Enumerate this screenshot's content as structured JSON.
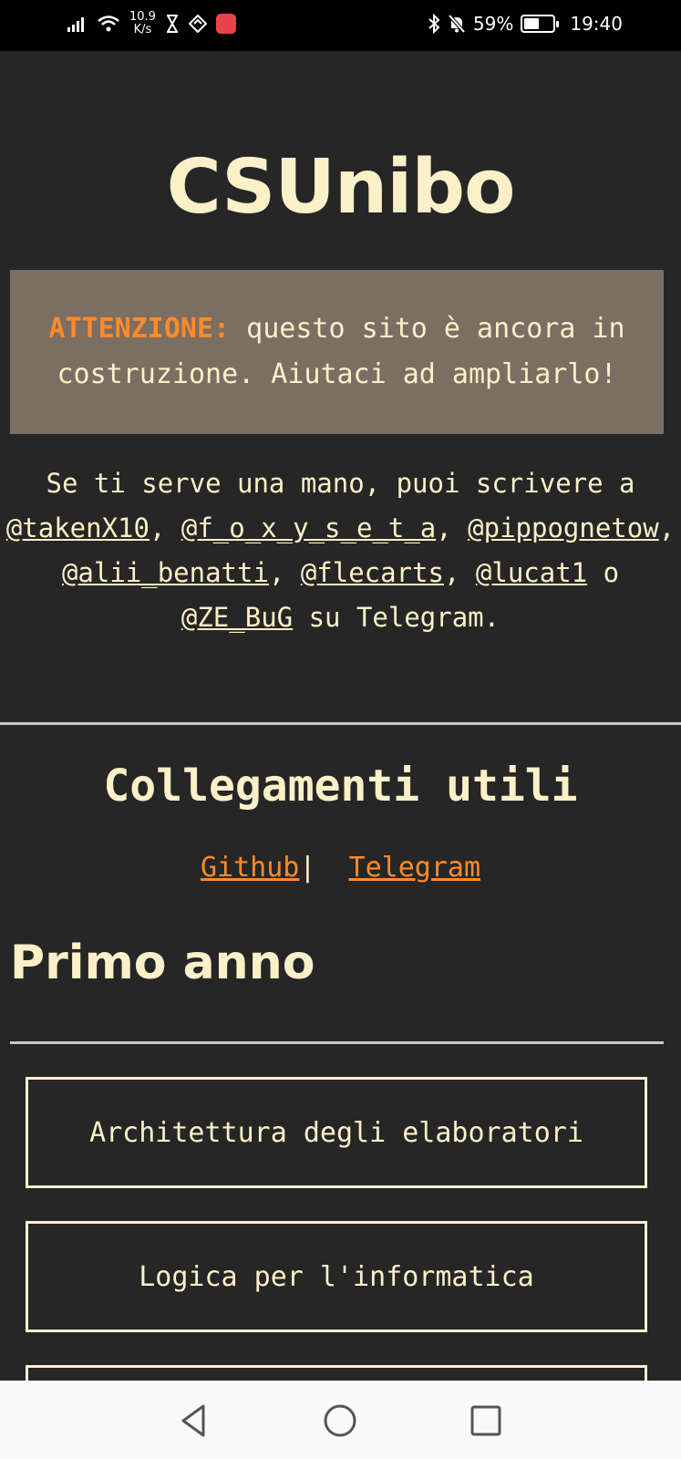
{
  "status_bar": {
    "net_speed_value": "10.9",
    "net_speed_unit": "K/s",
    "battery": "59%",
    "battery_level": 0.59,
    "time": "19:40"
  },
  "page": {
    "title": "CSUnibo",
    "warning": {
      "label": "ATTENZIONE:",
      "text": " questo sito è ancora in costruzione. Aiutaci ad ampliarlo!"
    },
    "help": {
      "intro": "Se ti serve una mano, puoi scrivere a ",
      "contacts": [
        "@takenX10",
        "@f_o_x_y_s_e_t_a",
        "@pippognetow",
        "@alii_benatti",
        "@flecarts",
        "@lucat1",
        "@ZE_BuG"
      ],
      "sep": ", ",
      "or": " o ",
      "outro": " su Telegram."
    },
    "links_title": "Collegamenti utili",
    "links": {
      "github": "Github",
      "separator": "|",
      "telegram": "Telegram"
    },
    "section_title": "Primo anno",
    "courses": [
      "Architettura degli elaboratori",
      "Logica per l'informatica",
      ""
    ]
  },
  "colors": {
    "background": "#262626",
    "text": "#fbf0c8",
    "accent": "#ff8a2a",
    "warning_bg": "#7b6e63"
  },
  "icons": {
    "nav": [
      "back-triangle-icon",
      "home-circle-icon",
      "recents-square-icon"
    ]
  }
}
